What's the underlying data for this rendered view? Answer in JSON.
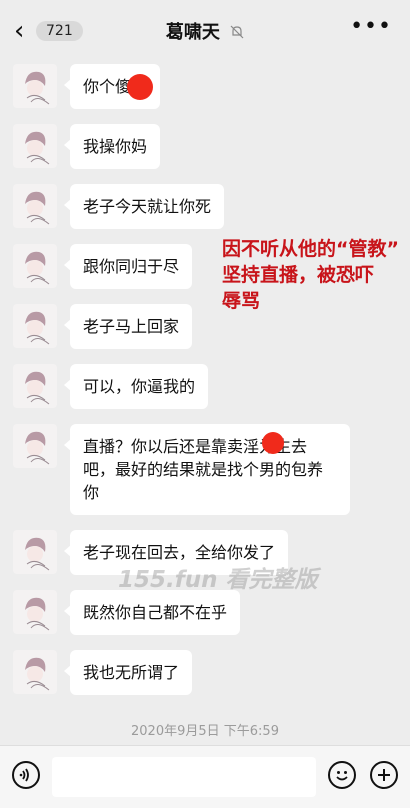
{
  "header": {
    "back_icon": "chevron-left-icon",
    "unread_count": "721",
    "title": "葛啸天",
    "mute_icon": "bell-off-icon",
    "more_icon": "more-dots-icon"
  },
  "messages": [
    {
      "text": "你个傻逼"
    },
    {
      "text": "我操你妈"
    },
    {
      "text": "老子今天就让你死"
    },
    {
      "text": "跟你同归于尽"
    },
    {
      "text": "老子马上回家"
    },
    {
      "text": "可以，你逼我的"
    },
    {
      "text": "直播？你以后还是靠卖淫为生去吧，最好的结果就是找个男的包养你"
    },
    {
      "text": "老子现在回去，全给你发了"
    },
    {
      "text": "既然你自己都不在乎"
    },
    {
      "text": "我也无所谓了"
    }
  ],
  "annotation": {
    "line1": "因不听从他的“管教”",
    "line2": "坚持直播，被恐吓",
    "line3": "辱骂",
    "color": "#c8141a"
  },
  "watermark": "155.fun 看完整版",
  "timestamp": "2020年9月5日 下午6:59",
  "bottom_bar": {
    "voice_icon": "voice-icon",
    "emoji_icon": "emoji-icon",
    "add_icon": "plus-icon"
  }
}
